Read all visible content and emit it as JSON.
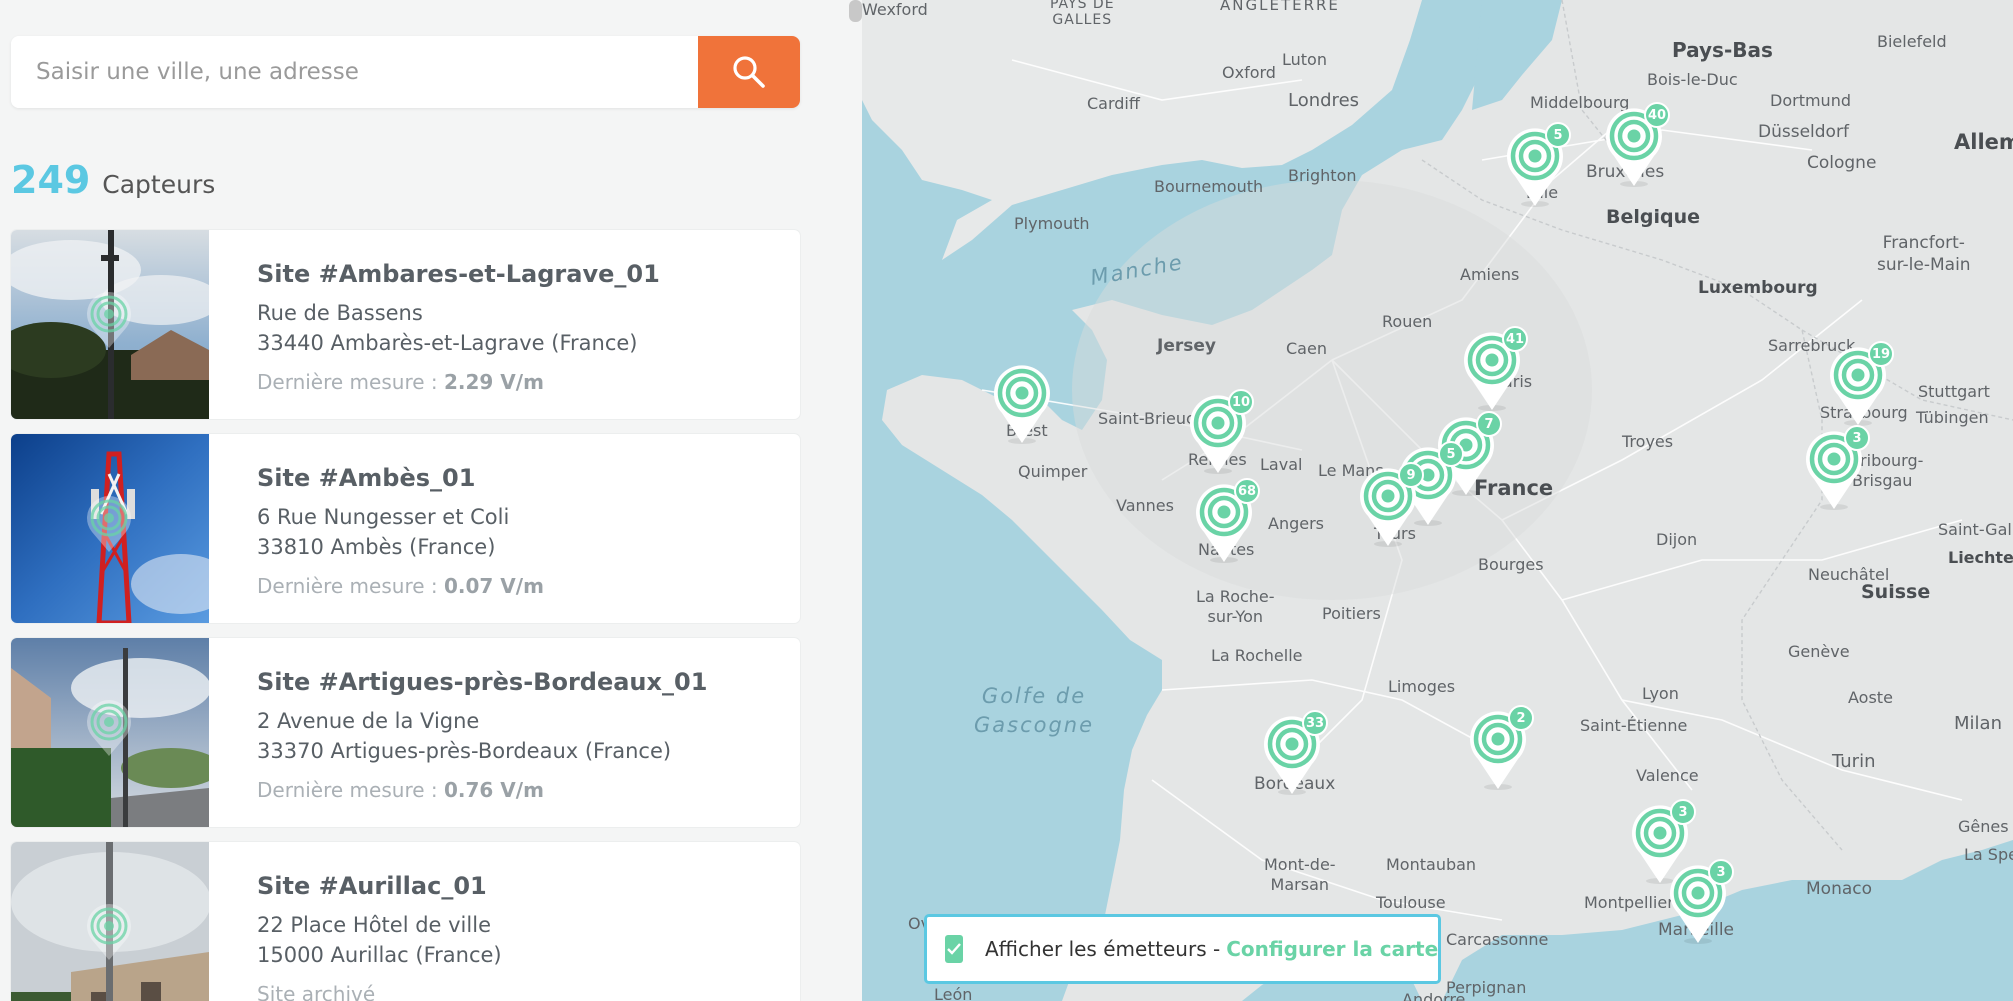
{
  "search": {
    "placeholder": "Saisir une ville, une adresse"
  },
  "sensors": {
    "count": "249",
    "count_label": "Capteurs"
  },
  "sites": [
    {
      "title": "Site #Ambares-et-Lagrave_01",
      "address": "Rue de Bassens",
      "city": "33440 Ambarès-et-Lagrave (France)",
      "measure_label": "Dernière mesure : ",
      "measure_value": "2.29 V/m"
    },
    {
      "title": "Site #Ambès_01",
      "address": "6 Rue Nungesser et Coli",
      "city": "33810 Ambès (France)",
      "measure_label": "Dernière mesure : ",
      "measure_value": "0.07 V/m"
    },
    {
      "title": "Site #Artigues-près-Bordeaux_01",
      "address": "2 Avenue de la Vigne",
      "city": "33370 Artigues-près-Bordeaux (France)",
      "measure_label": "Dernière mesure : ",
      "measure_value": "0.76 V/m"
    },
    {
      "title": "Site #Aurillac_01",
      "address": "22 Place Hôtel de ville",
      "city": "15000 Aurillac (France)",
      "measure_label": "Site archivé",
      "measure_value": ""
    }
  ],
  "map": {
    "labels": {
      "wexford": "Wexford",
      "pays_de_galles": "PAYS DE\nGALLES",
      "angleterre": "ANGLETERRE",
      "pays_bas": "Pays-Bas",
      "bielefeld": "Bielefeld",
      "luton": "Luton",
      "oxford": "Oxford",
      "londres": "Londres",
      "cardiff": "Cardiff",
      "middelbourg": "Middelbourg",
      "bois_le_duc": "Bois-le-Duc",
      "dortmund": "Dortmund",
      "dusseldorf": "Düsseldorf",
      "allem": "Allem",
      "bruxelles": "Bruxelles",
      "cologne": "Cologne",
      "bournemouth": "Bournemouth",
      "brighton": "Brighton",
      "belgique": "Belgique",
      "plymouth": "Plymouth",
      "francfort": "Francfort-\nsur-le-Main",
      "lille": "Lille",
      "manche": "Manche",
      "amiens": "Amiens",
      "luxembourg": "Luxembourg",
      "rouen": "Rouen",
      "jersey": "Jersey",
      "caen": "Caen",
      "sarrebruck": "Sarrebruck",
      "paris": "Paris",
      "stuttgart": "Stuttgart",
      "brest": "Brest",
      "saint_brieuc": "Saint-Brieuc",
      "strasbourg": "Strasbourg",
      "tubingen": "Tübingen",
      "rennes": "Rennes",
      "laval": "Laval",
      "le_mans": "Le Mans",
      "troyes": "Troyes",
      "quimper": "Quimper",
      "france": "France",
      "fribourg": "Fribourg-\nBrisgau",
      "vannes": "Vannes",
      "angers": "Angers",
      "tours": "Tours",
      "nantes": "Nantes",
      "dijon": "Dijon",
      "saint_gall": "Saint-Gall",
      "liechtenstein": "Liechtenstein",
      "bourges": "Bourges",
      "neuchatel": "Neuchâtel",
      "la_roche": "La Roche-\nsur-Yon",
      "poitiers": "Poitiers",
      "suisse": "Suisse",
      "la_rochelle": "La Rochelle",
      "geneve": "Genève",
      "limoges": "Limoges",
      "golfe": "Golfe de\nGascogne",
      "lyon": "Lyon",
      "aoste": "Aoste",
      "saint_etienne": "Saint-Étienne",
      "milan": "Milan",
      "bordeaux": "Bordeaux",
      "valence": "Valence",
      "turin": "Turin",
      "genes": "Gênes",
      "la_spe": "La Spe",
      "mont_de_marsan": "Mont-de-\nMarsan",
      "montauban": "Montauban",
      "toulouse": "Toulouse",
      "monaco": "Monaco",
      "montpellier": "Montpellier",
      "carcassonne": "Carcassonne",
      "marseille": "Marseille",
      "perpignan": "Perpignan",
      "leon": "León",
      "andorre": "Andorre",
      "ov": "Ov"
    },
    "markers": [
      {
        "id": "lille",
        "count": "5"
      },
      {
        "id": "bruxelles",
        "count": "40"
      },
      {
        "id": "paris",
        "count": "41"
      },
      {
        "id": "strasbourg",
        "count": "19"
      },
      {
        "id": "brest",
        "count": ""
      },
      {
        "id": "rennes",
        "count": "10"
      },
      {
        "id": "fribourg",
        "count": "3"
      },
      {
        "id": "orleans",
        "count": "7"
      },
      {
        "id": "blois",
        "count": "5"
      },
      {
        "id": "tours",
        "count": "9"
      },
      {
        "id": "nantes",
        "count": "68"
      },
      {
        "id": "bordeaux",
        "count": "33"
      },
      {
        "id": "clermont",
        "count": "2"
      },
      {
        "id": "avignon",
        "count": "3"
      },
      {
        "id": "marseille",
        "count": "3"
      }
    ]
  },
  "toggle": {
    "label": "Afficher les émetteurs - ",
    "link": "Configurer la carte"
  },
  "colors": {
    "accent_orange": "#f0733a",
    "accent_blue": "#5bc8e2",
    "marker_green": "#6ad3a6"
  }
}
